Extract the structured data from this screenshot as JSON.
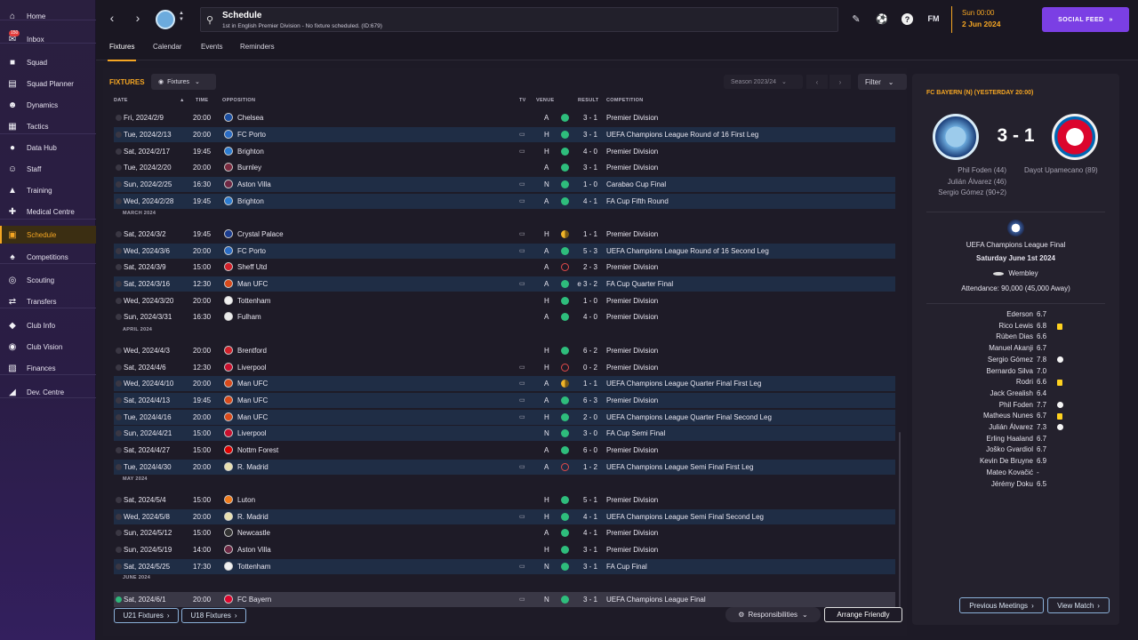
{
  "sidebar": {
    "items": [
      {
        "label": "Home",
        "icon": "home-icon"
      },
      {
        "label": "Inbox",
        "icon": "inbox-icon",
        "badge": "150"
      },
      {
        "label": "Squad",
        "icon": "shirt-icon"
      },
      {
        "label": "Squad Planner",
        "icon": "planner-icon"
      },
      {
        "label": "Dynamics",
        "icon": "people-icon"
      },
      {
        "label": "Tactics",
        "icon": "tactics-icon"
      },
      {
        "label": "Data Hub",
        "icon": "data-icon"
      },
      {
        "label": "Staff",
        "icon": "staff-icon"
      },
      {
        "label": "Training",
        "icon": "training-icon"
      },
      {
        "label": "Medical Centre",
        "icon": "medical-icon"
      },
      {
        "label": "Schedule",
        "icon": "calendar-icon",
        "active": true
      },
      {
        "label": "Competitions",
        "icon": "trophy-icon"
      },
      {
        "label": "Scouting",
        "icon": "scouting-icon"
      },
      {
        "label": "Transfers",
        "icon": "transfers-icon"
      },
      {
        "label": "Club Info",
        "icon": "shield-icon"
      },
      {
        "label": "Club Vision",
        "icon": "vision-icon"
      },
      {
        "label": "Finances",
        "icon": "finances-icon"
      },
      {
        "label": "Dev. Centre",
        "icon": "dev-icon"
      }
    ]
  },
  "header": {
    "title": "Schedule",
    "subtitle": "1st in English Premier Division - No fixture scheduled. (ID:679)",
    "fm_logo": "FM",
    "date_time": "Sun 00:00",
    "date": "2 Jun 2024",
    "social_feed": "SOCIAL FEED"
  },
  "tabs": [
    "Fixtures",
    "Calendar",
    "Events",
    "Reminders"
  ],
  "fixtures": {
    "title": "FIXTURES",
    "view_dropdown": "Fixtures",
    "season_dropdown": "Season 2023/24",
    "filter": "Filter",
    "headers": {
      "date": "DATE",
      "time": "TIME",
      "opposition": "OPPOSITION",
      "tv": "TV",
      "venue": "VENUE",
      "result": "RESULT",
      "competition": "COMPETITION"
    },
    "months": {
      "march": "MARCH 2024",
      "april": "APRIL 2024",
      "may": "MAY 2024",
      "june": "JUNE 2024"
    },
    "rows": [
      {
        "date": "Fri, 2024/2/9",
        "time": "20:00",
        "opp": "Chelsea",
        "tv": false,
        "venue": "A",
        "outcome": "W",
        "result": "3 - 1",
        "comp": "Premier Division",
        "crest": "#1c4fa0"
      },
      {
        "date": "Tue, 2024/2/13",
        "time": "20:00",
        "opp": "FC Porto",
        "tv": true,
        "venue": "H",
        "outcome": "W",
        "result": "3 - 1",
        "comp": "UEFA Champions League Round of 16  First Leg",
        "crest": "#2a6cc4"
      },
      {
        "date": "Sat, 2024/2/17",
        "time": "19:45",
        "opp": "Brighton",
        "tv": true,
        "venue": "H",
        "outcome": "W",
        "result": "4 - 0",
        "comp": "Premier Division",
        "crest": "#2c7cd0"
      },
      {
        "date": "Tue, 2024/2/20",
        "time": "20:00",
        "opp": "Burnley",
        "tv": false,
        "venue": "A",
        "outcome": "W",
        "result": "3 - 1",
        "comp": "Premier Division",
        "crest": "#7a2a3f"
      },
      {
        "date": "Sun, 2024/2/25",
        "time": "16:30",
        "opp": "Aston Villa",
        "tv": true,
        "venue": "N",
        "outcome": "W",
        "result": "1 - 0",
        "comp": "Carabao Cup Final",
        "crest": "#6e2844"
      },
      {
        "date": "Wed, 2024/2/28",
        "time": "19:45",
        "opp": "Brighton",
        "tv": true,
        "venue": "A",
        "outcome": "W",
        "result": "4 - 1",
        "comp": "FA Cup Fifth Round",
        "crest": "#2c7cd0"
      },
      {
        "date": "Sat, 2024/3/2",
        "time": "19:45",
        "opp": "Crystal Palace",
        "tv": true,
        "venue": "H",
        "outcome": "D",
        "result": "1 - 1",
        "comp": "Premier Division",
        "crest": "#1b3d8f"
      },
      {
        "date": "Wed, 2024/3/6",
        "time": "20:00",
        "opp": "FC Porto",
        "tv": true,
        "venue": "A",
        "outcome": "W",
        "result": "5 - 3",
        "comp": "UEFA Champions League Round of 16  Second Leg",
        "crest": "#2a6cc4"
      },
      {
        "date": "Sat, 2024/3/9",
        "time": "15:00",
        "opp": "Sheff Utd",
        "tv": false,
        "venue": "A",
        "outcome": "L",
        "result": "2 - 3",
        "comp": "Premier Division",
        "crest": "#d0202a"
      },
      {
        "date": "Sat, 2024/3/16",
        "time": "12:30",
        "opp": "Man UFC",
        "tv": true,
        "venue": "A",
        "outcome": "W",
        "result": "e 3 - 2",
        "comp": "FA Cup Quarter Final",
        "crest": "#d84a1b"
      },
      {
        "date": "Wed, 2024/3/20",
        "time": "20:00",
        "opp": "Tottenham",
        "tv": false,
        "venue": "H",
        "outcome": "W",
        "result": "1 - 0",
        "comp": "Premier Division",
        "crest": "#f0f0f0"
      },
      {
        "date": "Sun, 2024/3/31",
        "time": "16:30",
        "opp": "Fulham",
        "tv": false,
        "venue": "A",
        "outcome": "W",
        "result": "4 - 0",
        "comp": "Premier Division",
        "crest": "#eaeaea"
      },
      {
        "date": "Wed, 2024/4/3",
        "time": "20:00",
        "opp": "Brentford",
        "tv": false,
        "venue": "H",
        "outcome": "W",
        "result": "6 - 2",
        "comp": "Premier Division",
        "crest": "#d0202a"
      },
      {
        "date": "Sat, 2024/4/6",
        "time": "12:30",
        "opp": "Liverpool",
        "tv": true,
        "venue": "H",
        "outcome": "L",
        "result": "0 - 2",
        "comp": "Premier Division",
        "crest": "#c8102e"
      },
      {
        "date": "Wed, 2024/4/10",
        "time": "20:00",
        "opp": "Man UFC",
        "tv": true,
        "venue": "A",
        "outcome": "D",
        "result": "1 - 1",
        "comp": "UEFA Champions League Quarter Final First Leg",
        "crest": "#d84a1b"
      },
      {
        "date": "Sat, 2024/4/13",
        "time": "19:45",
        "opp": "Man UFC",
        "tv": true,
        "venue": "A",
        "outcome": "W",
        "result": "6 - 3",
        "comp": "Premier Division",
        "crest": "#d84a1b"
      },
      {
        "date": "Tue, 2024/4/16",
        "time": "20:00",
        "opp": "Man UFC",
        "tv": true,
        "venue": "H",
        "outcome": "W",
        "result": "2 - 0",
        "comp": "UEFA Champions League Quarter Final Second Leg",
        "crest": "#d84a1b"
      },
      {
        "date": "Sun, 2024/4/21",
        "time": "15:00",
        "opp": "Liverpool",
        "tv": false,
        "venue": "N",
        "outcome": "W",
        "result": "3 - 0",
        "comp": "FA Cup Semi Final",
        "crest": "#c8102e"
      },
      {
        "date": "Sat, 2024/4/27",
        "time": "15:00",
        "opp": "Nottm Forest",
        "tv": false,
        "venue": "A",
        "outcome": "W",
        "result": "6 - 0",
        "comp": "Premier Division",
        "crest": "#dd0000"
      },
      {
        "date": "Tue, 2024/4/30",
        "time": "20:00",
        "opp": "R. Madrid",
        "tv": true,
        "venue": "A",
        "outcome": "L",
        "result": "1 - 2",
        "comp": "UEFA Champions League Semi Final First Leg",
        "crest": "#e8e0b0"
      },
      {
        "date": "Sat, 2024/5/4",
        "time": "15:00",
        "opp": "Luton",
        "tv": false,
        "venue": "H",
        "outcome": "W",
        "result": "5 - 1",
        "comp": "Premier Division",
        "crest": "#f07a1a"
      },
      {
        "date": "Wed, 2024/5/8",
        "time": "20:00",
        "opp": "R. Madrid",
        "tv": true,
        "venue": "H",
        "outcome": "W",
        "result": "4 - 1",
        "comp": "UEFA Champions League Semi Final Second Leg",
        "crest": "#e8e0b0"
      },
      {
        "date": "Sun, 2024/5/12",
        "time": "15:00",
        "opp": "Newcastle",
        "tv": false,
        "venue": "A",
        "outcome": "W",
        "result": "4 - 1",
        "comp": "Premier Division",
        "crest": "#333333"
      },
      {
        "date": "Sun, 2024/5/19",
        "time": "14:00",
        "opp": "Aston Villa",
        "tv": false,
        "venue": "H",
        "outcome": "W",
        "result": "3 - 1",
        "comp": "Premier Division",
        "crest": "#6e2844"
      },
      {
        "date": "Sat, 2024/5/25",
        "time": "17:30",
        "opp": "Tottenham",
        "tv": true,
        "venue": "N",
        "outcome": "W",
        "result": "3 - 1",
        "comp": "FA Cup Final",
        "crest": "#f0f0f0"
      },
      {
        "date": "Sat, 2024/6/1",
        "time": "20:00",
        "opp": "FC Bayern",
        "tv": true,
        "venue": "N",
        "outcome": "W",
        "result": "3 - 1",
        "comp": "UEFA Champions League Final",
        "crest": "#dc052d"
      }
    ],
    "footer": {
      "u21": "U21 Fixtures",
      "u18": "U18 Fixtures",
      "responsibilities": "Responsibilities",
      "arrange": "Arrange Friendly"
    }
  },
  "match_panel": {
    "heading": "FC BAYERN (N) (YESTERDAY 20:00)",
    "score": "3 - 1",
    "home_scorers": [
      "Phil Foden (44)",
      "Julián Álvarez (46)",
      "Sergio Gómez (90+2)"
    ],
    "away_scorers": [
      "Dayot Upamecano (89)"
    ],
    "competition": "UEFA Champions League Final",
    "date": "Saturday June 1st 2024",
    "stadium": "Wembley",
    "attendance": "Attendance: 90,000 (45,000 Away)",
    "players": [
      {
        "name": "Ederson",
        "rating": "6.7",
        "icon": ""
      },
      {
        "name": "Rico Lewis",
        "rating": "6.8",
        "icon": "yellow"
      },
      {
        "name": "Rúben Dias",
        "rating": "6.6",
        "icon": ""
      },
      {
        "name": "Manuel Akanji",
        "rating": "6.7",
        "icon": ""
      },
      {
        "name": "Sergio Gómez",
        "rating": "7.8",
        "icon": "ball"
      },
      {
        "name": "Bernardo Silva",
        "rating": "7.0",
        "icon": ""
      },
      {
        "name": "Rodri",
        "rating": "6.6",
        "icon": "yellow"
      },
      {
        "name": "Jack Grealish",
        "rating": "6.4",
        "icon": ""
      },
      {
        "name": "Phil Foden",
        "rating": "7.7",
        "icon": "ball"
      },
      {
        "name": "Matheus Nunes",
        "rating": "6.7",
        "icon": "yellow"
      },
      {
        "name": "Julián Álvarez",
        "rating": "7.3",
        "icon": "ball"
      },
      {
        "name": "Erling Haaland",
        "rating": "6.7",
        "icon": ""
      },
      {
        "name": "Joško Gvardiol",
        "rating": "6.7",
        "icon": ""
      },
      {
        "name": "Kevin De Bruyne",
        "rating": "6.9",
        "icon": ""
      },
      {
        "name": "Mateo Kovačić",
        "rating": "-",
        "icon": ""
      },
      {
        "name": "Jérémy Doku",
        "rating": "6.5",
        "icon": ""
      }
    ],
    "prev_meetings": "Previous Meetings",
    "view_match": "View Match"
  }
}
